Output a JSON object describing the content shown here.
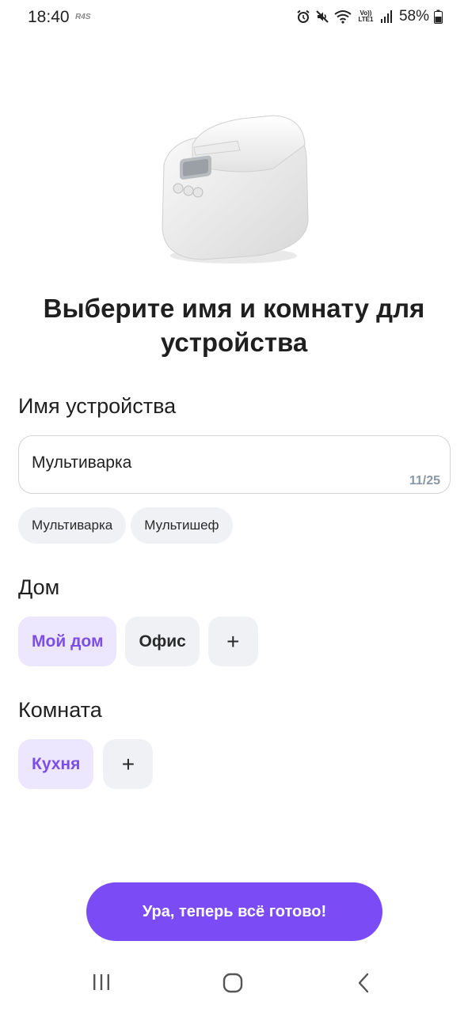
{
  "status_bar": {
    "time": "18:40",
    "carrier": "R4S",
    "volte": "Vo)) LTE1",
    "battery": "58%"
  },
  "device": {
    "image_icon": "multicooker-icon"
  },
  "title": "Выберите имя и комнату для устройства",
  "name_section": {
    "label": "Имя устройства",
    "value": "Мультиварка",
    "counter": "11/25",
    "suggestions": [
      "Мультиварка",
      "Мультишеф"
    ]
  },
  "home_section": {
    "label": "Дом",
    "options": [
      "Мой дом",
      "Офис"
    ],
    "selected": "Мой дом",
    "add_label": "+"
  },
  "room_section": {
    "label": "Комната",
    "options": [
      "Кухня"
    ],
    "selected": "Кухня",
    "add_label": "+"
  },
  "cta": {
    "label": "Ура, теперь всё готово!"
  },
  "colors": {
    "accent": "#7b4bf5",
    "selected_bg": "#ece6ff",
    "chip_bg": "#f0f1f4"
  }
}
